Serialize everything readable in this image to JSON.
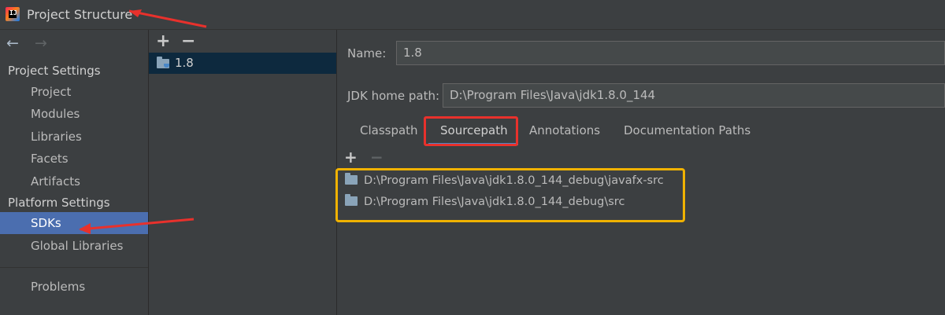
{
  "window": {
    "title": "Project Structure",
    "logo_text": "IJ"
  },
  "sidebar": {
    "project_settings_header": "Project Settings",
    "project_items": [
      "Project",
      "Modules",
      "Libraries",
      "Facets",
      "Artifacts"
    ],
    "platform_settings_header": "Platform Settings",
    "platform_items": [
      "SDKs",
      "Global Libraries"
    ],
    "selected_item": "SDKs",
    "problems": "Problems"
  },
  "sdk_list": {
    "items": [
      {
        "label": "1.8",
        "icon": "jdk-folder-icon"
      }
    ]
  },
  "detail": {
    "name_label": "Name:",
    "name_value": "1.8",
    "jdk_home_label": "JDK home path:",
    "jdk_home_value": "D:\\Program Files\\Java\\jdk1.8.0_144",
    "tabs": [
      "Classpath",
      "Sourcepath",
      "Annotations",
      "Documentation Paths"
    ],
    "active_tab": "Sourcepath",
    "source_paths": [
      "D:\\Program Files\\Java\\jdk1.8.0_144_debug\\javafx-src",
      "D:\\Program Files\\Java\\jdk1.8.0_144_debug\\src"
    ]
  },
  "annotations": {
    "arrow_color": "#e8312c",
    "tab_box_color": "#e8312c",
    "paths_box_color": "#f0b200"
  },
  "colors": {
    "background": "#3c3f41",
    "selection": "#4b6eaf",
    "sdk_row_selection": "#0d293e",
    "accent": "#4a88c7"
  }
}
